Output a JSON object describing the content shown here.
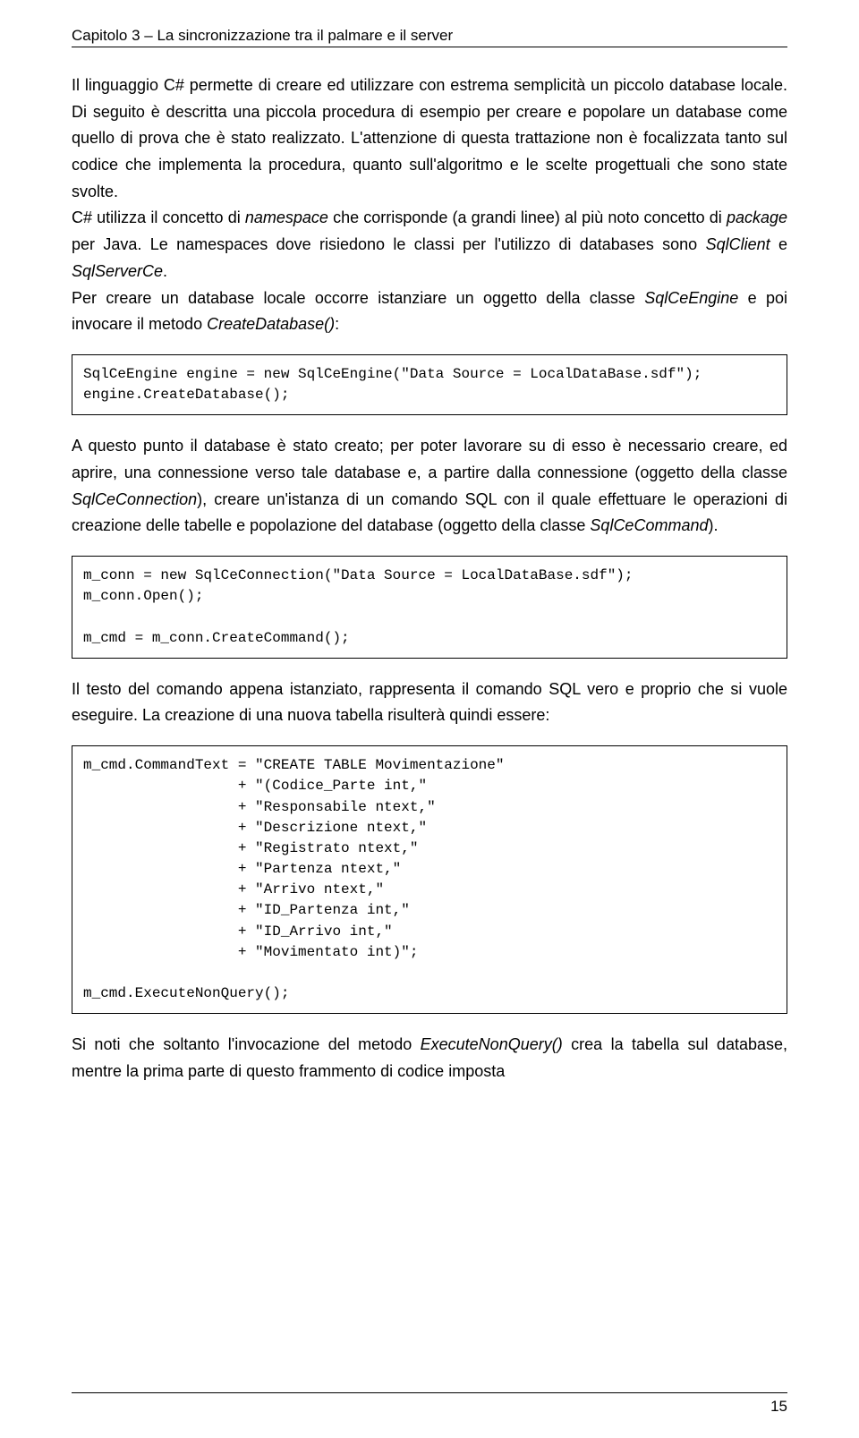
{
  "header": "Capitolo 3 – La sincronizzazione tra il palmare e il server",
  "para1_a": "Il linguaggio C# permette di creare ed utilizzare con estrema semplicità un piccolo database locale. Di seguito è descritta una piccola procedura di esempio per creare e popolare un database come quello di prova che è stato realizzato. L'attenzione di questa trattazione non è focalizzata tanto sul codice che implementa la procedura, quanto sull'algoritmo e le scelte progettuali che sono state svolte.",
  "para1_b": "C# utilizza il concetto di ",
  "para1_b_i1": "namespace",
  "para1_b2": " che corrisponde (a grandi linee) al più noto concetto di ",
  "para1_b_i2": "package",
  "para1_b3": " per Java. Le namespaces dove risiedono le classi per l'utilizzo di databases sono ",
  "para1_b_i3": "SqlClient",
  "para1_b4": " e ",
  "para1_b_i4": "SqlServerCe",
  "para1_b5": ".",
  "para1_c": "Per creare un database locale occorre istanziare un oggetto della classe ",
  "para1_c_i1": "SqlCeEngine",
  "para1_c2": " e poi invocare il metodo ",
  "para1_c_i2": "CreateDatabase()",
  "para1_c3": ":",
  "code1": "SqlCeEngine engine = new SqlCeEngine(\"Data Source = LocalDataBase.sdf\");\nengine.CreateDatabase();",
  "para2_a": "A questo punto il database è stato creato; per poter lavorare su di esso è necessario creare, ed aprire, una connessione verso tale database e, a partire dalla connessione (oggetto della classe ",
  "para2_i1": "SqlCeConnection",
  "para2_b": "), creare un'istanza di un comando SQL con il quale effettuare le operazioni di creazione delle tabelle e popolazione del database (oggetto della classe ",
  "para2_i2": "SqlCeCommand",
  "para2_c": ").",
  "code2": "m_conn = new SqlCeConnection(\"Data Source = LocalDataBase.sdf\");\nm_conn.Open();\n\nm_cmd = m_conn.CreateCommand();",
  "para3": "Il testo del comando appena istanziato, rappresenta il comando SQL vero e proprio che si vuole eseguire. La creazione di una nuova tabella risulterà quindi essere:",
  "code3": "m_cmd.CommandText = \"CREATE TABLE Movimentazione\"\n                  + \"(Codice_Parte int,\"\n                  + \"Responsabile ntext,\"\n                  + \"Descrizione ntext,\"\n                  + \"Registrato ntext,\"\n                  + \"Partenza ntext,\"\n                  + \"Arrivo ntext,\"\n                  + \"ID_Partenza int,\"\n                  + \"ID_Arrivo int,\"\n                  + \"Movimentato int)\";\n\nm_cmd.ExecuteNonQuery();",
  "para4_a": "Si noti che soltanto l'invocazione del metodo ",
  "para4_i1": "ExecuteNonQuery()",
  "para4_b": " crea la tabella sul database, mentre la prima parte di questo frammento di codice imposta",
  "pageNumber": "15"
}
